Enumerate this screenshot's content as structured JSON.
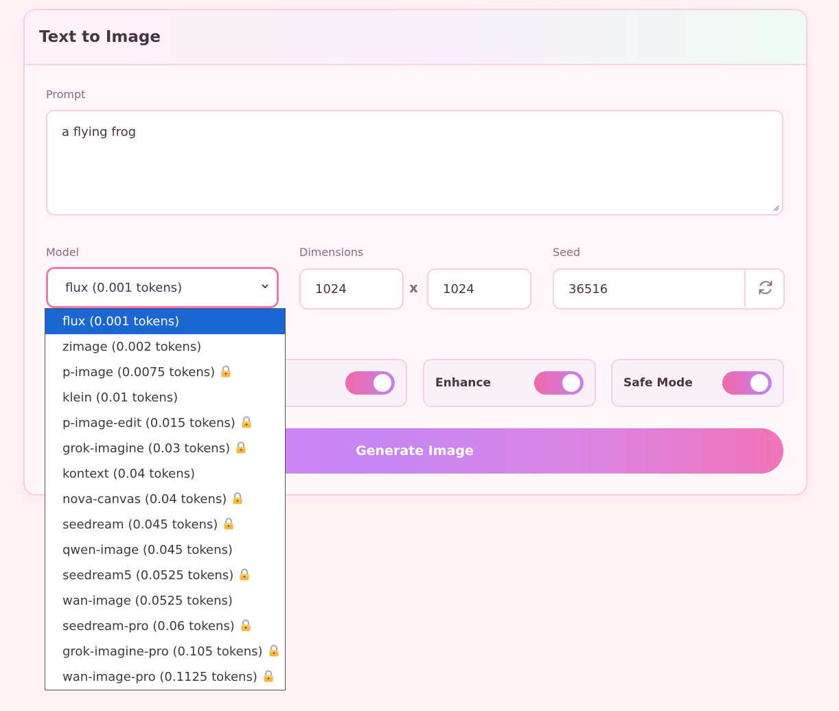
{
  "card": {
    "title": "Text to Image"
  },
  "prompt": {
    "label": "Prompt",
    "value": "a flying frog"
  },
  "model": {
    "label": "Model",
    "selected": "flux (0.001 tokens)",
    "options": [
      {
        "label": "flux (0.001 tokens)",
        "locked": false,
        "selected": true
      },
      {
        "label": "zimage (0.002 tokens)",
        "locked": false
      },
      {
        "label": "p-image (0.0075 tokens)",
        "locked": true
      },
      {
        "label": "klein (0.01 tokens)",
        "locked": false
      },
      {
        "label": "p-image-edit (0.015 tokens)",
        "locked": true
      },
      {
        "label": "grok-imagine (0.03 tokens)",
        "locked": true
      },
      {
        "label": "kontext (0.04 tokens)",
        "locked": false
      },
      {
        "label": "nova-canvas (0.04 tokens)",
        "locked": true
      },
      {
        "label": "seedream (0.045 tokens)",
        "locked": true
      },
      {
        "label": "qwen-image (0.045 tokens)",
        "locked": false
      },
      {
        "label": "seedream5 (0.0525 tokens)",
        "locked": true
      },
      {
        "label": "wan-image (0.0525 tokens)",
        "locked": false
      },
      {
        "label": "seedream-pro (0.06 tokens)",
        "locked": true
      },
      {
        "label": "grok-imagine-pro (0.105 tokens)",
        "locked": true
      },
      {
        "label": "wan-image-pro (0.1125 tokens)",
        "locked": true
      }
    ]
  },
  "dimensions": {
    "label": "Dimensions",
    "width": "1024",
    "separator": "x",
    "height": "1024"
  },
  "seed": {
    "label": "Seed",
    "value": "36516",
    "refresh_icon": "refresh-icon"
  },
  "toggles": {
    "first": {
      "label": "",
      "on": true
    },
    "enhance": {
      "label": "Enhance",
      "on": true
    },
    "safe_mode": {
      "label": "Safe Mode",
      "on": true
    }
  },
  "generate_button": {
    "label": "Generate Image"
  },
  "colors": {
    "accent_pink": "#f27aab",
    "selected_option": "#1a66d2",
    "toggle_gradient_start": "#f06aa8",
    "toggle_gradient_end": "#c77ff0"
  }
}
